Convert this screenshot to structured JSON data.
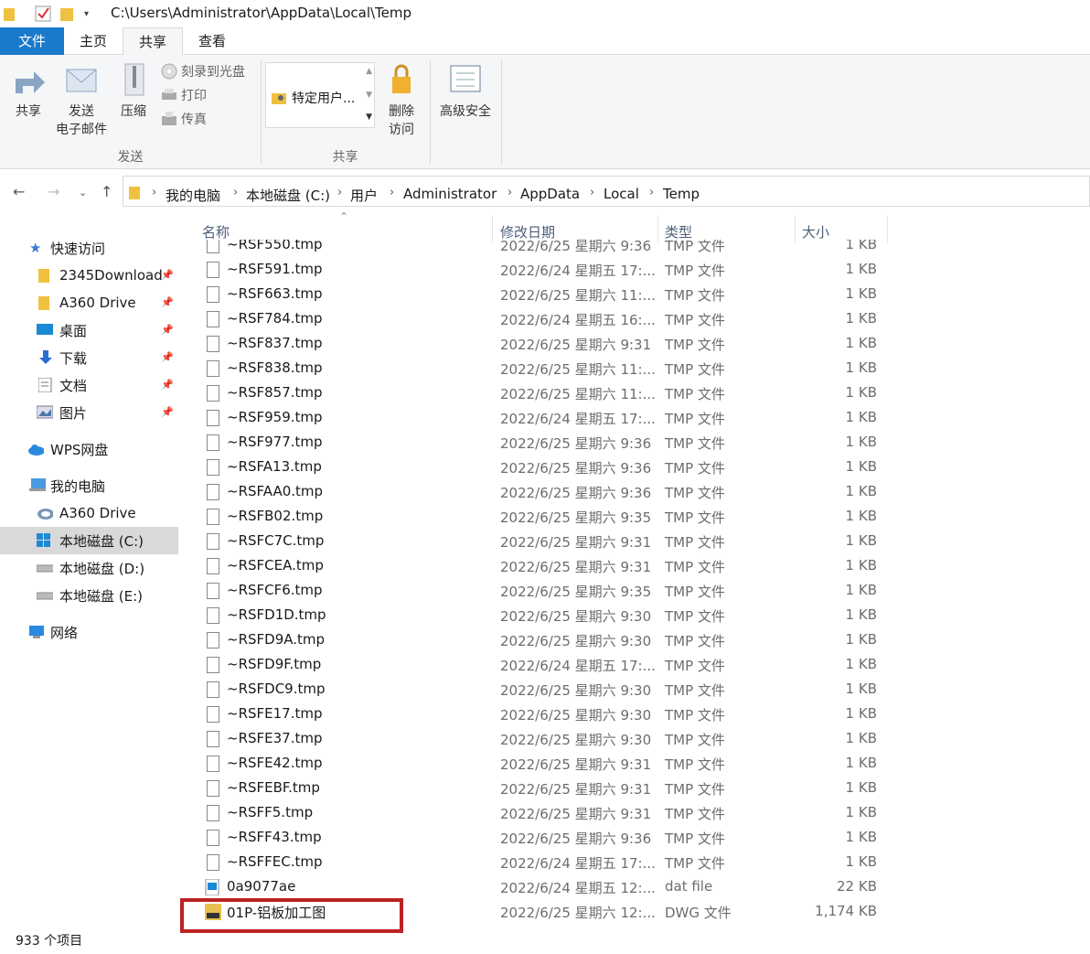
{
  "window": {
    "title_path": "C:\\Users\\Administrator\\AppData\\Local\\Temp"
  },
  "ribbon_tabs": [
    {
      "label": "文件"
    },
    {
      "label": "主页"
    },
    {
      "label": "共享"
    },
    {
      "label": "查看"
    }
  ],
  "ribbon": {
    "share": "共享",
    "email_line1": "发送",
    "email_line2": "电子邮件",
    "zip": "压缩",
    "burn": "刻录到光盘",
    "print": "打印",
    "fax": "传真",
    "group_send": "发送",
    "specific_users": "特定用户...",
    "remove_line1": "删除",
    "remove_line2": "访问",
    "advanced_security": "高级安全",
    "group_share": "共享"
  },
  "breadcrumb": [
    "我的电脑",
    "本地磁盘 (C:)",
    "用户",
    "Administrator",
    "AppData",
    "Local",
    "Temp"
  ],
  "nav": {
    "quick_access": "快速访问",
    "items": [
      {
        "label": "2345Download",
        "icon": "folder-icon"
      },
      {
        "label": "A360 Drive",
        "icon": "folder-icon"
      },
      {
        "label": "桌面",
        "icon": "desktop-icon"
      },
      {
        "label": "下载",
        "icon": "download-icon"
      },
      {
        "label": "文档",
        "icon": "document-icon"
      },
      {
        "label": "图片",
        "icon": "pictures-icon"
      }
    ],
    "wps": "WPS网盘",
    "this_pc": "我的电脑",
    "pc_items": [
      {
        "label": "A360 Drive",
        "icon": "cloud-drive-icon"
      },
      {
        "label": "本地磁盘 (C:)",
        "icon": "windows-drive-icon"
      },
      {
        "label": "本地磁盘 (D:)",
        "icon": "drive-icon"
      },
      {
        "label": "本地磁盘 (E:)",
        "icon": "drive-icon"
      }
    ],
    "network": "网络"
  },
  "columns": {
    "name": "名称",
    "date": "修改日期",
    "type": "类型",
    "size": "大小"
  },
  "files": [
    {
      "name": "~RSF550.tmp",
      "date": "2022/6/25 星期六 9:36",
      "type": "TMP 文件",
      "size": "1 KB"
    },
    {
      "name": "~RSF591.tmp",
      "date": "2022/6/24 星期五 17:...",
      "type": "TMP 文件",
      "size": "1 KB"
    },
    {
      "name": "~RSF663.tmp",
      "date": "2022/6/25 星期六 11:...",
      "type": "TMP 文件",
      "size": "1 KB"
    },
    {
      "name": "~RSF784.tmp",
      "date": "2022/6/24 星期五 16:...",
      "type": "TMP 文件",
      "size": "1 KB"
    },
    {
      "name": "~RSF837.tmp",
      "date": "2022/6/25 星期六 9:31",
      "type": "TMP 文件",
      "size": "1 KB"
    },
    {
      "name": "~RSF838.tmp",
      "date": "2022/6/25 星期六 11:...",
      "type": "TMP 文件",
      "size": "1 KB"
    },
    {
      "name": "~RSF857.tmp",
      "date": "2022/6/25 星期六 11:...",
      "type": "TMP 文件",
      "size": "1 KB"
    },
    {
      "name": "~RSF959.tmp",
      "date": "2022/6/24 星期五 17:...",
      "type": "TMP 文件",
      "size": "1 KB"
    },
    {
      "name": "~RSF977.tmp",
      "date": "2022/6/25 星期六 9:36",
      "type": "TMP 文件",
      "size": "1 KB"
    },
    {
      "name": "~RSFA13.tmp",
      "date": "2022/6/25 星期六 9:36",
      "type": "TMP 文件",
      "size": "1 KB"
    },
    {
      "name": "~RSFAA0.tmp",
      "date": "2022/6/25 星期六 9:36",
      "type": "TMP 文件",
      "size": "1 KB"
    },
    {
      "name": "~RSFB02.tmp",
      "date": "2022/6/25 星期六 9:35",
      "type": "TMP 文件",
      "size": "1 KB"
    },
    {
      "name": "~RSFC7C.tmp",
      "date": "2022/6/25 星期六 9:31",
      "type": "TMP 文件",
      "size": "1 KB"
    },
    {
      "name": "~RSFCEA.tmp",
      "date": "2022/6/25 星期六 9:31",
      "type": "TMP 文件",
      "size": "1 KB"
    },
    {
      "name": "~RSFCF6.tmp",
      "date": "2022/6/25 星期六 9:35",
      "type": "TMP 文件",
      "size": "1 KB"
    },
    {
      "name": "~RSFD1D.tmp",
      "date": "2022/6/25 星期六 9:30",
      "type": "TMP 文件",
      "size": "1 KB"
    },
    {
      "name": "~RSFD9A.tmp",
      "date": "2022/6/25 星期六 9:30",
      "type": "TMP 文件",
      "size": "1 KB"
    },
    {
      "name": "~RSFD9F.tmp",
      "date": "2022/6/24 星期五 17:...",
      "type": "TMP 文件",
      "size": "1 KB"
    },
    {
      "name": "~RSFDC9.tmp",
      "date": "2022/6/25 星期六 9:30",
      "type": "TMP 文件",
      "size": "1 KB"
    },
    {
      "name": "~RSFE17.tmp",
      "date": "2022/6/25 星期六 9:30",
      "type": "TMP 文件",
      "size": "1 KB"
    },
    {
      "name": "~RSFE37.tmp",
      "date": "2022/6/25 星期六 9:30",
      "type": "TMP 文件",
      "size": "1 KB"
    },
    {
      "name": "~RSFE42.tmp",
      "date": "2022/6/25 星期六 9:31",
      "type": "TMP 文件",
      "size": "1 KB"
    },
    {
      "name": "~RSFEBF.tmp",
      "date": "2022/6/25 星期六 9:31",
      "type": "TMP 文件",
      "size": "1 KB"
    },
    {
      "name": "~RSFF5.tmp",
      "date": "2022/6/25 星期六 9:31",
      "type": "TMP 文件",
      "size": "1 KB"
    },
    {
      "name": "~RSFF43.tmp",
      "date": "2022/6/25 星期六 9:36",
      "type": "TMP 文件",
      "size": "1 KB"
    },
    {
      "name": "~RSFFEC.tmp",
      "date": "2022/6/24 星期五 17:...",
      "type": "TMP 文件",
      "size": "1 KB"
    },
    {
      "name": "0a9077ae",
      "date": "2022/6/24 星期五 12:...",
      "type": "dat file",
      "size": "22 KB",
      "icon": "dat-file-icon"
    },
    {
      "name": "01P-铝板加工图",
      "date": "2022/6/25 星期六 12:...",
      "type": "DWG 文件",
      "size": "1,174 KB",
      "icon": "dwg-file-icon"
    }
  ],
  "status": {
    "item_count": "933 个项目"
  },
  "colors": {
    "accent": "#1979ca",
    "highlight_box": "#b22222"
  }
}
